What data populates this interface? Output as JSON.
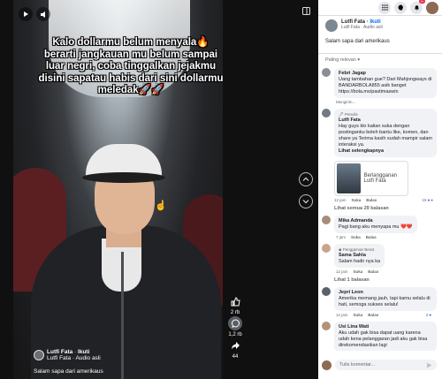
{
  "video": {
    "caption": "Kalo dollarmu belum menyala🔥 berarti jangkauan mu belum sampai luar negri, coba tinggalkan jejakmu disini sapatau habis dari sini dollarmu meledak🚀🚀",
    "author": "Lutfi Fata",
    "follow": "Ikuti",
    "audio": "Lutfi Fata · Audio asli",
    "text": "Salam sapa dari amerikaus"
  },
  "actions": {
    "likes": "2 rb",
    "comments": "1,2 rb",
    "shares": "44"
  },
  "panel": {
    "author": "Lutfi Fata",
    "follow": "Ikuti",
    "audio": "Lutfi Fata · Audio asli",
    "post_text": "Salam sapa dari amerikaus",
    "sort": "Paling relevan",
    "notif_count": "9+",
    "composer_placeholder": "Tulis komentar..."
  },
  "comments": [
    {
      "name": "Febri Jagap",
      "text": "Uang tambahan gue? Dari Mahjongways di BANDARBOLA855 asik banget https://bola.ms/pastimaswin",
      "time": "Mengirim..."
    },
    {
      "tag": "Penulis",
      "name": "Lutfi Fata",
      "text": "Hay guys klo kalian suka dengan postinganku boleh bantu like, komen, dan share ya Terima kasih sudah mampir salam interaksi ya.",
      "more": "Lihat selengkapnya",
      "card": "Berlangganan Lutfi Fata",
      "time": "12 jam",
      "like": "Suka",
      "reply": "Balas",
      "count": "15",
      "link": "Lihat semua 29 balasan"
    },
    {
      "name": "Mika Admanda",
      "text": "Pagi bang aku menyapa mu ❤️❤️",
      "time": "7 jam",
      "like": "Suka",
      "reply": "Balas"
    },
    {
      "tag": "Penggemar Berat",
      "name": "Sama Sahla",
      "text": "Salam hadir nya ka",
      "time": "12 jam",
      "like": "Suka",
      "reply": "Balas",
      "link": "Lihat 1 balasan"
    },
    {
      "name": "Jepri Leon",
      "text": "Amerika memang jauh, tapi kamu selalu di hati, semoga sukses selalu!",
      "time": "12 jam",
      "like": "Suka",
      "reply": "Balas",
      "count": "2"
    },
    {
      "name": "Usi Lina Wati",
      "text": "Aku udah gak bisa dapat uang karena udah kena pelanggaran jadi aku gak bisa direkomendasikan lagi"
    }
  ]
}
